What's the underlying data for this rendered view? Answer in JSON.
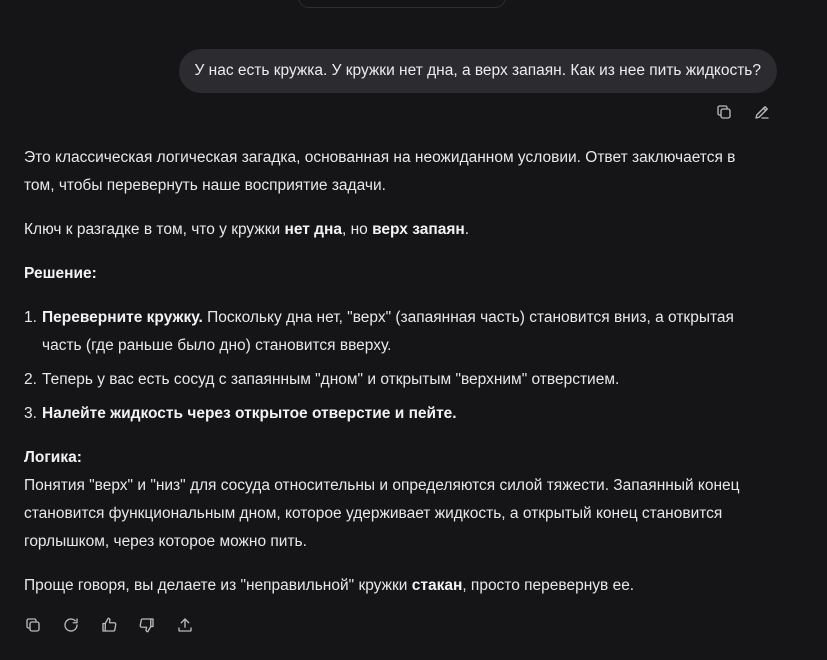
{
  "user_message": "У нас есть кружка. У кружки нет дна, а верх запаян. Как из нее пить жидкость?",
  "message_actions": {
    "copy_icon": "copy-icon",
    "edit_icon": "edit-icon"
  },
  "answer": {
    "intro": "Это классическая логическая загадка, основанная на неожиданном условии. Ответ заключается в том, чтобы перевернуть наше восприятие задачи.",
    "key": {
      "pre": "Ключ к разгадке в том, что у кружки ",
      "bold1": "нет дна",
      "mid": ", но ",
      "bold2": "верх запаян",
      "post": "."
    },
    "solution_title": "Решение:",
    "steps": [
      {
        "num": "1.",
        "bold": "Переверните кружку.",
        "text": " Поскольку дна нет, \"верх\" (запаянная часть) становится вниз, а открытая часть (где раньше было дно) становится вверху."
      },
      {
        "num": "2.",
        "bold": "",
        "text": "Теперь у вас есть сосуд с запаянным \"дном\" и открытым \"верхним\" отверстием."
      },
      {
        "num": "3.",
        "bold": "Налейте жидкость через открытое отверстие и пейте.",
        "text": ""
      }
    ],
    "logic_title": "Логика:",
    "logic_body": "Понятия \"верх\" и \"низ\" для сосуда относительны и определяются силой тяжести. Запаянный конец становится функциональным дном, которое удерживает жидкость, а открытый конец становится горлышком, через которое можно пить.",
    "conclusion": {
      "pre": "Проще говоря, вы делаете из \"неправильной\" кружки ",
      "bold": "стакан",
      "post": ", просто перевернув ее."
    }
  },
  "answer_actions": [
    "copy-icon",
    "regenerate-icon",
    "thumbs-up-icon",
    "thumbs-down-icon",
    "share-icon"
  ]
}
